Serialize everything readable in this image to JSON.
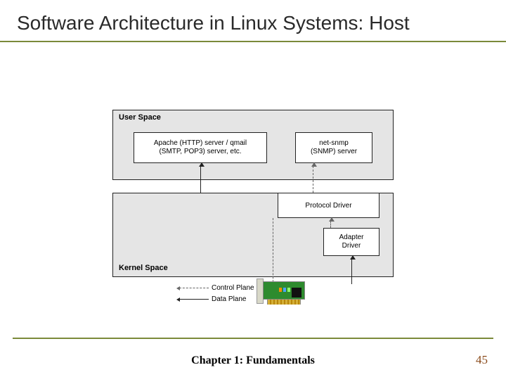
{
  "slide": {
    "title": "Software Architecture in Linux Systems: Host",
    "chapter": "Chapter 1: Fundamentals",
    "page": "45"
  },
  "diagram": {
    "user_space_label": "User Space",
    "kernel_space_label": "Kernel Space",
    "apache_line1": "Apache (HTTP) server / qmail",
    "apache_line2": "(SMTP, POP3) server, etc.",
    "snmp_line1": "net-snmp",
    "snmp_line2": "(SNMP) server",
    "protocol_driver": "Protocol Driver",
    "adapter_line1": "Adapter",
    "adapter_line2": "Driver",
    "legend_control": "Control Plane",
    "legend_data": "Data Plane"
  }
}
